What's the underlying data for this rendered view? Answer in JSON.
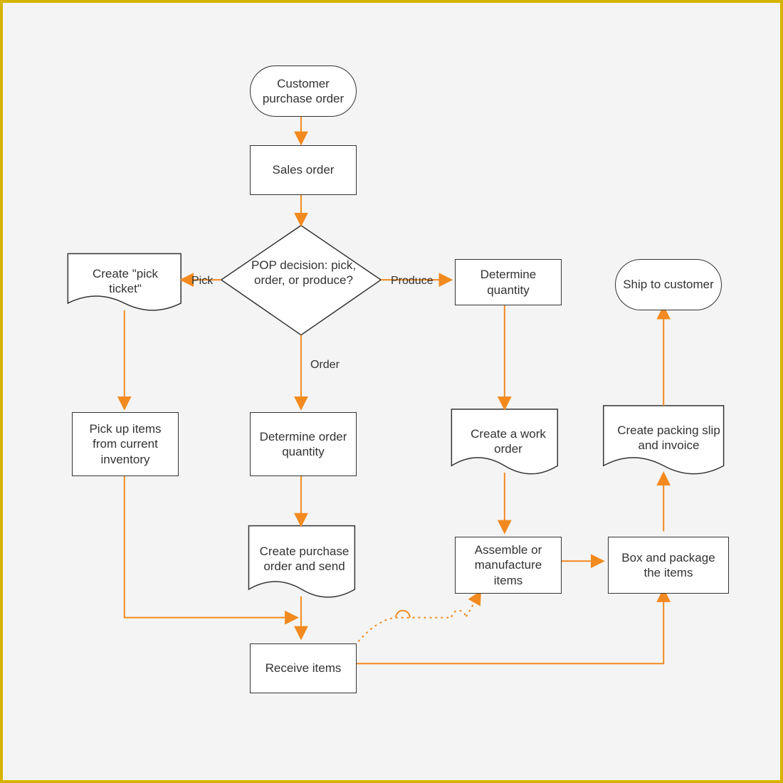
{
  "nodes": {
    "start": "Customer purchase order",
    "sales": "Sales order",
    "pop": "POP decision: pick, order, or produce?",
    "pick_ticket": "Create \"pick ticket\"",
    "det_qty": "Determine quantity",
    "ship": "Ship to customer",
    "pick_inv": "Pick up items from current inventory",
    "det_order_qty": "Determine order quantity",
    "work_order": "Create a work order",
    "pack_slip": "Create packing slip and invoice",
    "create_po": "Create purchase order and send",
    "assemble": "Assemble or manufacture items",
    "box": "Box and package the items",
    "receive": "Receive items"
  },
  "edge_labels": {
    "pick": "Pick",
    "produce": "Produce",
    "order": "Order"
  },
  "colors": {
    "arrow": "#f28a1f",
    "node_border": "#333333",
    "frame_border": "#d4b400",
    "canvas": "#f4f4f4"
  }
}
